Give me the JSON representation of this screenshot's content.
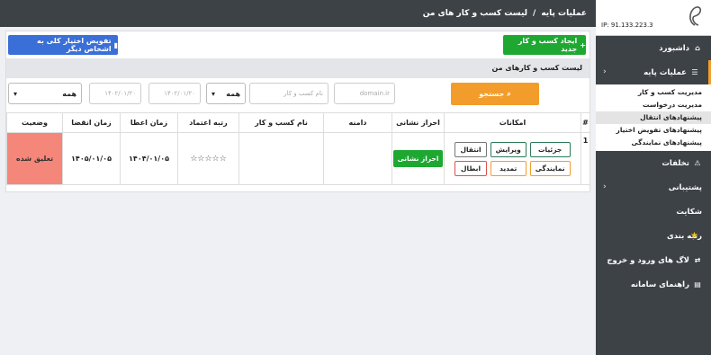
{
  "sidebar": {
    "ip": "IP: 91.133.223.3",
    "items": [
      {
        "label": "داشبورد",
        "icon": "home-icon"
      },
      {
        "label": "عملیات پایه",
        "icon": "list-icon"
      },
      {
        "label": "تخلفات",
        "icon": "warning-icon"
      },
      {
        "label": "پشتیبانی",
        "icon": "support-icon"
      },
      {
        "label": "شکایت",
        "icon": "complaint-icon"
      },
      {
        "label": "رتبه بندی",
        "icon": "star-icon"
      },
      {
        "label": "لاگ های ورود و خروج",
        "icon": "log-icon"
      },
      {
        "label": "راهنمای سامانه",
        "icon": "book-icon"
      }
    ],
    "sub_items": [
      {
        "label": "مدیریت کسب و کار"
      },
      {
        "label": "مدیریت درخواست"
      },
      {
        "label": "پیشنهادهای انتقال"
      },
      {
        "label": "پیشنهادهای تفویض اختیار"
      },
      {
        "label": "پیشنهادهای نمایندگی"
      }
    ]
  },
  "breadcrumb": {
    "parent": "عملیات پایه",
    "separator": "/",
    "current": "لیست کسب و کار های من"
  },
  "buttons": {
    "new_business": "ایجاد کسب و کار جدید",
    "delegate": "تفویض اختیار کلی به اشخاص دیگر",
    "search": "جستجو"
  },
  "list_title": "لیست کسب و کارهای من",
  "filters": {
    "name_placeholder": "نام کسب و کار",
    "domain_placeholder": "domain.ir",
    "grant_date_placeholder": "۱۴۰۲/۰۱/۲۰",
    "expire_date_placeholder": "۱۴۰۲/۰۱/۲۰",
    "trust_select": "همه",
    "status_select": "همه"
  },
  "table": {
    "headers": [
      "#",
      "امکانات",
      "احراز نشانی",
      "دامنه",
      "نام کسب و کار",
      "رتبه اعتماد",
      "زمان اعطا",
      "زمان انقضا",
      "وضعیت"
    ],
    "rows": [
      {
        "index": "1",
        "options": [
          "جزئیات",
          "ویرایش",
          "انتقال",
          "نمایندگی",
          "تمدید",
          "ابطال"
        ],
        "auth_button": "احراز نشانی",
        "domain": "",
        "name": "",
        "stars": "☆☆☆☆☆",
        "grant_date": "۱۴۰۴/۰۱/۰۵",
        "expire_date": "۱۴۰۵/۰۱/۰۵",
        "status": "تعلیق شده"
      }
    ]
  },
  "colors": {
    "sidebar": "#3d4247",
    "green": "#1ea832",
    "blue": "#3a6fd8",
    "orange": "#f29d2b",
    "status_suspended": "#f4877a"
  }
}
